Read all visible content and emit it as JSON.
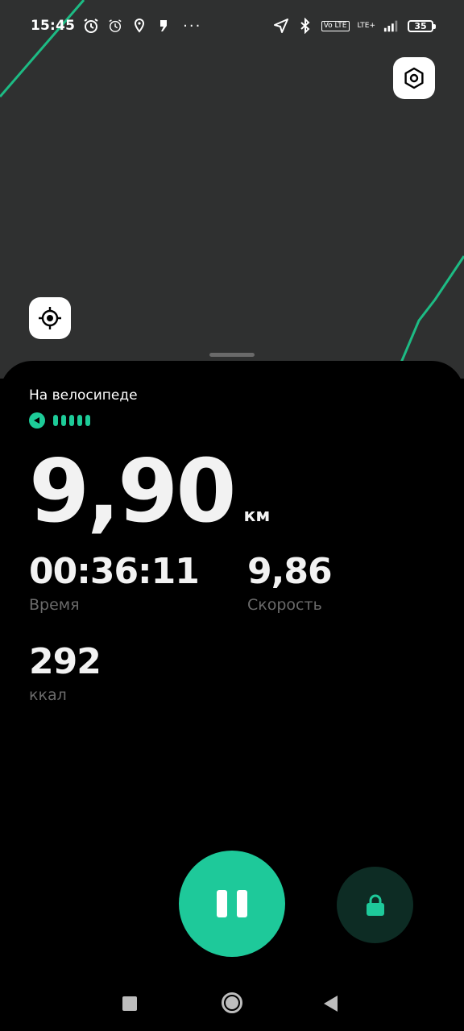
{
  "status_bar": {
    "time": "15:45",
    "battery": "35",
    "network": "LTE+",
    "volte": "Vo LTE"
  },
  "icons": {
    "settings": "hex-settings-icon",
    "locate": "crosshair-locate-icon",
    "pause": "pause-icon",
    "lock": "lock-icon"
  },
  "colors": {
    "accent": "#1ec99a",
    "route": "#1dbb84",
    "map_bg": "#2f3030",
    "label": "#6a6a6a"
  },
  "workout": {
    "activity": "На велосипеде",
    "distance": "9,90",
    "distance_unit": "км",
    "time_value": "00:36:11",
    "time_label": "Время",
    "speed_value": "9,86",
    "speed_label": "Скорость",
    "kcal_value": "292",
    "kcal_label": "ккал",
    "gps_signal_bars": 5
  }
}
